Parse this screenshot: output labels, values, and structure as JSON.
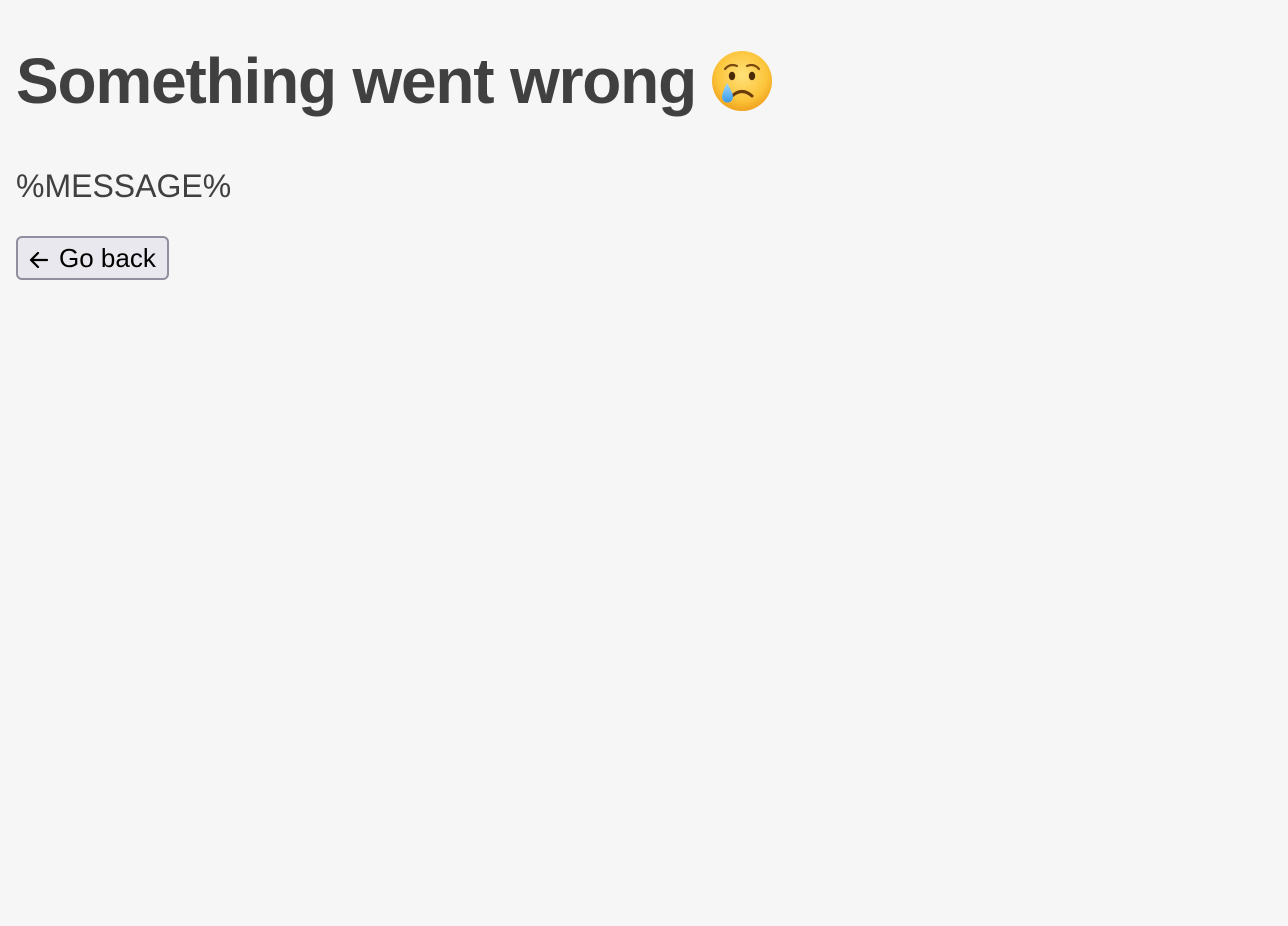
{
  "heading": {
    "text": "Something went wrong",
    "emoji_icon": "crying-face-icon"
  },
  "message": {
    "text": "%MESSAGE%"
  },
  "back_button": {
    "icon": "arrow-left-icon",
    "label": "Go back"
  },
  "colors": {
    "background": "#f6f6f6",
    "text": "#404040",
    "button_background": "#e9e8ee",
    "button_border": "#8f8f9d"
  }
}
